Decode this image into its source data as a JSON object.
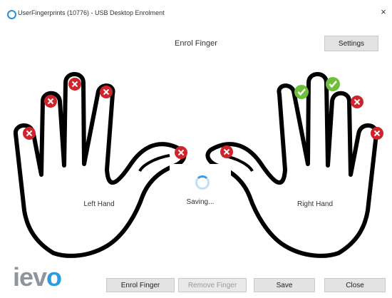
{
  "window": {
    "title": "UserFingerprints (10776) - USB Desktop Enrolment",
    "close_glyph": "×"
  },
  "header": {
    "title": "Enrol Finger"
  },
  "toolbar": {
    "settings_label": "Settings"
  },
  "hands": {
    "left_label": "Left Hand",
    "right_label": "Right Hand",
    "left_fingers": [
      {
        "finger": "little",
        "status": "not-enrolled",
        "icon": "x-icon"
      },
      {
        "finger": "ring",
        "status": "not-enrolled",
        "icon": "x-icon"
      },
      {
        "finger": "middle",
        "status": "not-enrolled",
        "icon": "x-icon"
      },
      {
        "finger": "index",
        "status": "not-enrolled",
        "icon": "x-icon"
      },
      {
        "finger": "thumb",
        "status": "not-enrolled",
        "icon": "x-icon"
      }
    ],
    "right_fingers": [
      {
        "finger": "thumb",
        "status": "not-enrolled",
        "icon": "x-icon"
      },
      {
        "finger": "index",
        "status": "enrolled",
        "icon": "check-icon"
      },
      {
        "finger": "middle",
        "status": "enrolled",
        "icon": "check-icon"
      },
      {
        "finger": "ring",
        "status": "not-enrolled",
        "icon": "x-icon"
      },
      {
        "finger": "little",
        "status": "not-enrolled",
        "icon": "x-icon"
      }
    ]
  },
  "status": {
    "saving_text": "Saving..."
  },
  "logo": {
    "text_main": "iev",
    "text_accent": "o"
  },
  "footer": {
    "enrol_label": "Enrol Finger",
    "remove_label": "Remove Finger",
    "save_label": "Save",
    "close_label": "Close"
  },
  "colors": {
    "not_enrolled": "#d0242c",
    "enrolled": "#6fbf3a",
    "accent": "#2c9ce0"
  }
}
